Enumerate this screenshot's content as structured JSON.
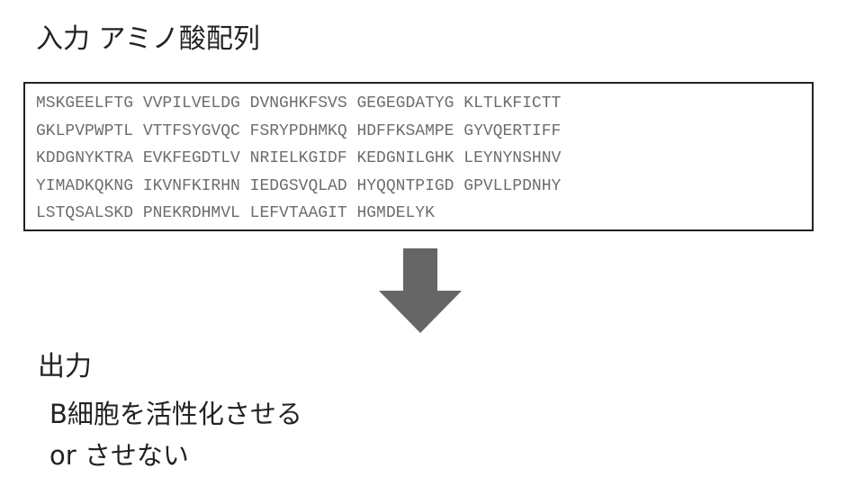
{
  "input": {
    "title": "入力 アミノ酸配列",
    "sequence_lines": [
      "MSKGEELFTG VVPILVELDG DVNGHKFSVS GEGEGDATYG KLTLKFICTT",
      "GKLPVPWPTL VTTFSYGVQC FSRYPDHMKQ HDFFKSAMPE GYVQERTIFF",
      "KDDGNYKTRA EVKFEGDTLV NRIELKGIDF KEDGNILGHK LEYNYNSHNV",
      "YIMADKQKNG IKVNFKIRHN IEDGSVQLAD HYQQNTPIGD GPVLLPDNHY",
      "LSTQSALSKD PNEKRDHMVL LEFVTAAGIT HGMDELYK"
    ]
  },
  "output": {
    "title": "出力",
    "options": [
      "B細胞を活性化させる",
      "or させない"
    ]
  },
  "colors": {
    "text": "#222222",
    "sequence_text": "#6d6d6d",
    "arrow": "#666666",
    "box_border": "#222222"
  },
  "icons": {
    "flow_arrow": "down-arrow-icon"
  }
}
